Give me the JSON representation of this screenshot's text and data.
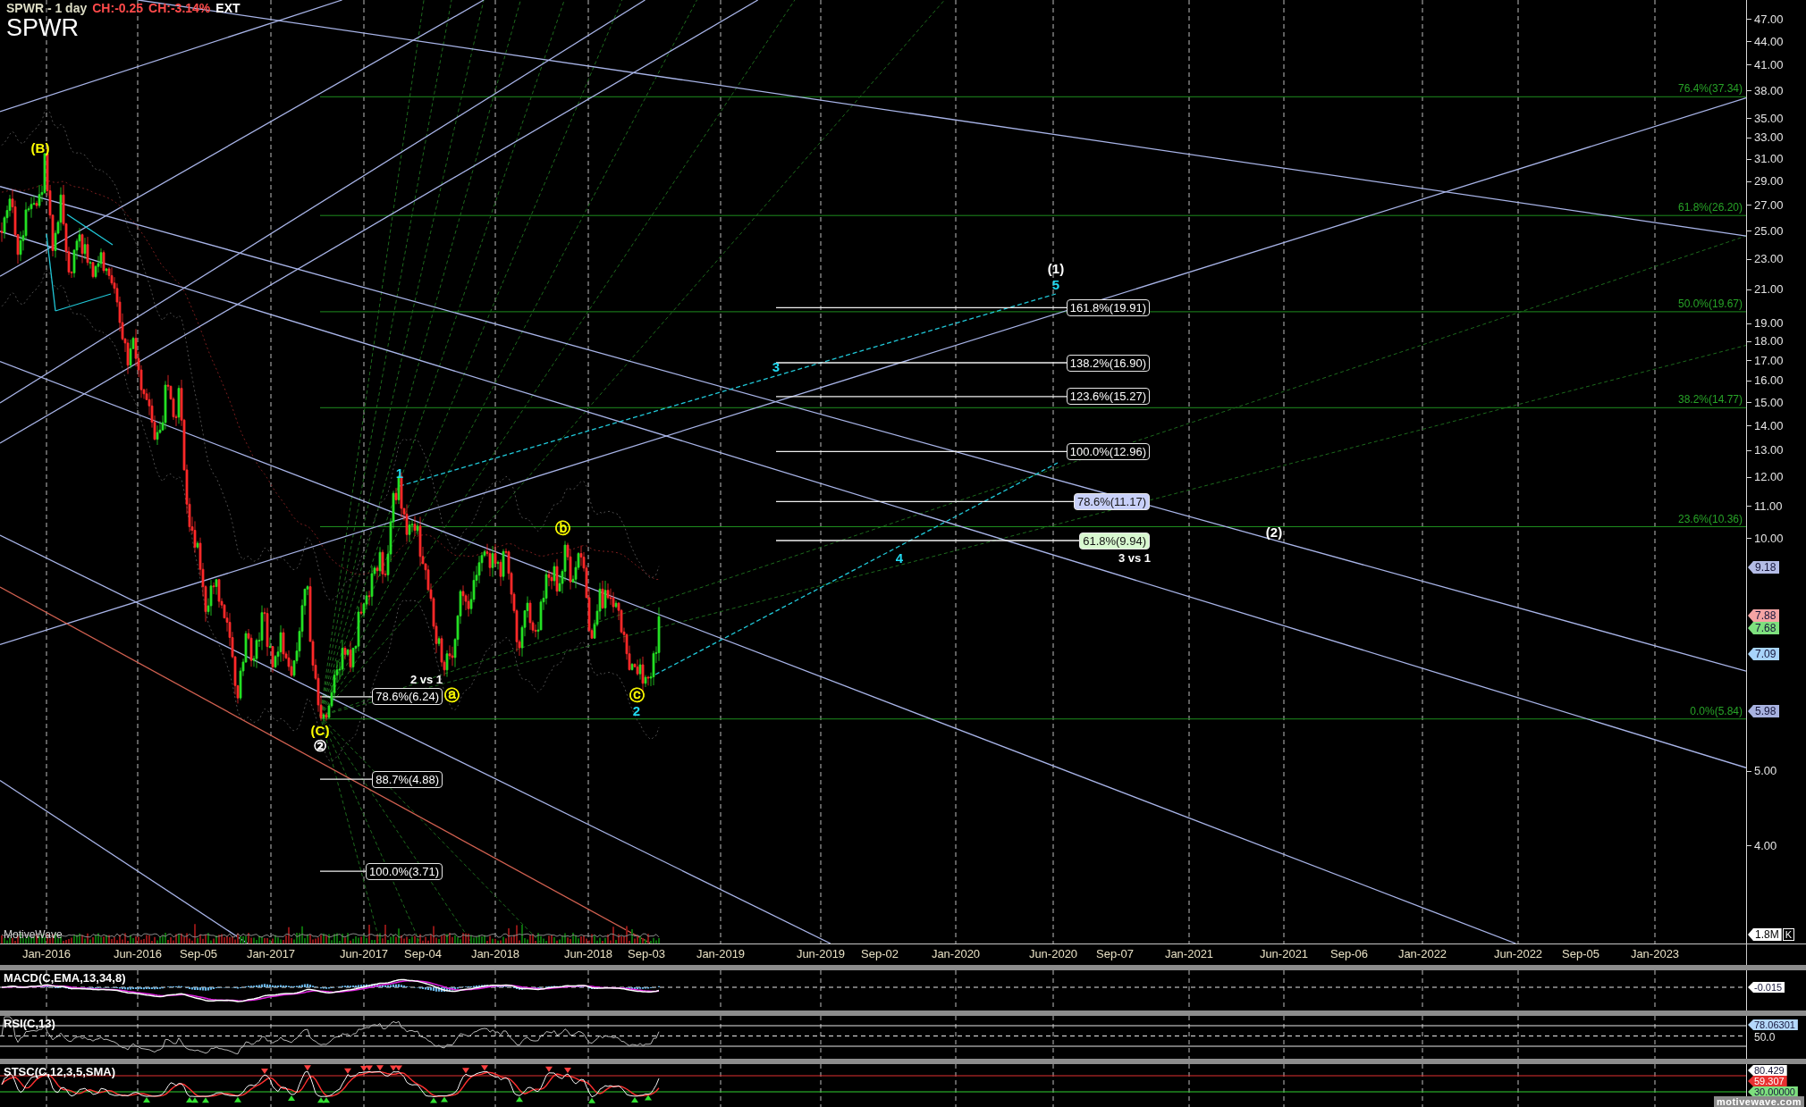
{
  "header": {
    "title": "SPWR - 1 day",
    "change": "CH:-0.25",
    "change_percent": "CH:-3.14%",
    "session": "EXT",
    "symbol": "SPWR"
  },
  "price_chart": {
    "wave_labels": [
      {
        "text": "(B)",
        "kind": "plain",
        "color": "#ffff00"
      },
      {
        "text": "(C)",
        "kind": "plain",
        "color": "#ffff00"
      },
      {
        "text": "②",
        "kind": "circled",
        "color": "#ffffff"
      },
      {
        "text": "1",
        "kind": "plain",
        "color": "#20d8f0"
      },
      {
        "text": "2 vs 1",
        "kind": "note",
        "color": "#ffffff"
      },
      {
        "text": "ⓐ",
        "kind": "circled",
        "color": "#ffff00"
      },
      {
        "text": "ⓑ",
        "kind": "circled",
        "color": "#ffff00"
      },
      {
        "text": "ⓒ",
        "kind": "circled",
        "color": "#ffff00"
      },
      {
        "text": "2",
        "kind": "plain",
        "color": "#20d8f0"
      },
      {
        "text": "3",
        "kind": "plain",
        "color": "#20d8f0"
      },
      {
        "text": "4",
        "kind": "plain",
        "color": "#20d8f0"
      },
      {
        "text": "(1)",
        "kind": "plain",
        "color": "#ffffff"
      },
      {
        "text": "5",
        "kind": "plain",
        "color": "#20d8f0"
      },
      {
        "text": "3 vs 1",
        "kind": "note",
        "color": "#ffffff"
      },
      {
        "text": "(2)",
        "kind": "plain",
        "color": "#ffffff"
      }
    ],
    "fib_extensions": [
      {
        "label": "161.8%(19.91)"
      },
      {
        "label": "138.2%(16.90)"
      },
      {
        "label": "123.6%(15.27)"
      },
      {
        "label": "100.0%(12.96)"
      },
      {
        "label": "78.6%(11.17)",
        "color": "#c8d0f8"
      },
      {
        "label": "61.8%(9.94)",
        "color": "#d8f8d0"
      }
    ],
    "fib_retracements": [
      {
        "label": "78.6%(6.24)"
      },
      {
        "label": "88.7%(4.88)"
      },
      {
        "label": "100.0%(3.71)"
      }
    ],
    "retracement_levels": [
      "76.4%(37.34)",
      "61.8%(26.20)",
      "50.0%(19.67)",
      "38.2%(14.77)",
      "23.6%(10.36)",
      "0.0%(5.84)"
    ],
    "branding": "MotiveWave"
  },
  "price_axis": {
    "ticks": [
      "47.00",
      "44.00",
      "41.00",
      "38.00",
      "35.00",
      "33.00",
      "31.00",
      "29.00",
      "27.00",
      "25.00",
      "23.00",
      "21.00",
      "19.00",
      "18.00",
      "17.00",
      "16.00",
      "15.00",
      "14.00",
      "13.00",
      "12.00",
      "11.00",
      "10.00",
      "5.00",
      "4.00"
    ],
    "price_tags": [
      {
        "text": "9.18",
        "color": "#b4bce6"
      },
      {
        "text": "7.88",
        "color": "#f4a4a4"
      },
      {
        "text": "7.68",
        "color": "#7ee07e"
      },
      {
        "text": "7.09",
        "color": "#a8d4fa"
      },
      {
        "text": "5.98",
        "color": "#a8b2e0"
      }
    ],
    "volume_tag": "1.8M",
    "volume_unit": "K"
  },
  "date_axis": [
    "Jan-2016",
    "Jun-2016",
    "Sep-05",
    "Jan-2017",
    "Jun-2017",
    "Sep-04",
    "Jan-2018",
    "Jun-2018",
    "Sep-03",
    "Jan-2019",
    "Jun-2019",
    "Sep-02",
    "Jan-2020",
    "Jun-2020",
    "Sep-07",
    "Jan-2021",
    "Jun-2021",
    "Sep-06",
    "Jan-2022",
    "Jun-2022",
    "Sep-05",
    "Jan-2023"
  ],
  "indicators": [
    {
      "kind": "macd",
      "title": "MACD(C,EMA,13,34,8)",
      "tags": [
        {
          "text": "-0.015",
          "color": "#ffffff"
        }
      ]
    },
    {
      "kind": "rsi",
      "title": "RSI(C,13)",
      "tags": [
        {
          "text": "78.06301",
          "color": "#b4d8fa"
        }
      ],
      "axis_labels": [
        "50.0"
      ]
    },
    {
      "kind": "stochastic",
      "title": "STSC(C,12,3,5,SMA)",
      "tags": [
        {
          "text": "80.429",
          "color": "#ffffff"
        },
        {
          "text": "59.307",
          "color": "#e83030"
        },
        {
          "text": "30.00000",
          "color": "#7ee07e"
        }
      ]
    }
  ],
  "footer": {
    "branding": "motivewave.com"
  }
}
